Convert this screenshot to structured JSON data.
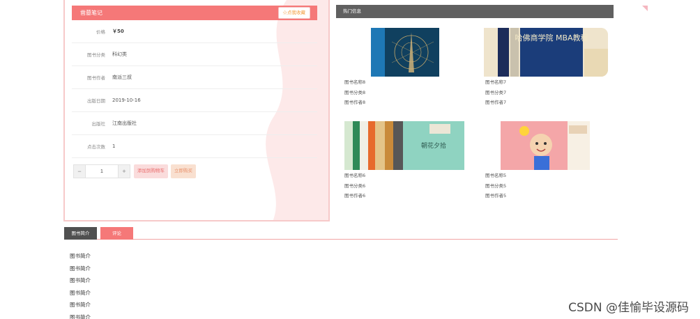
{
  "detail": {
    "title": "凿墓笔记",
    "collect_label": "☆点我收藏",
    "rows": [
      {
        "label": "价格",
        "value": "￥50"
      },
      {
        "label": "图书分类",
        "value": "科幻类"
      },
      {
        "label": "图书作者",
        "value": "南派三叔"
      },
      {
        "label": "出版日期",
        "value": "2019-10-16"
      },
      {
        "label": "出版社",
        "value": "江南出版社"
      },
      {
        "label": "点击次数",
        "value": "1"
      }
    ],
    "quantity": "1",
    "minus_label": "−",
    "plus_label": "+",
    "add_cart_label": "添加到购物车",
    "buy_now_label": "立即购买"
  },
  "hot": {
    "title": "热门信息",
    "items": [
      {
        "name": "图书名称8",
        "category": "图书分类8",
        "author": "图书作者8",
        "cover_title": ""
      },
      {
        "name": "图书名称7",
        "category": "图书分类7",
        "author": "图书作者7",
        "cover_title": "哈佛商学院 MBA教程"
      },
      {
        "name": "图书名称6",
        "category": "图书分类6",
        "author": "图书作者6",
        "cover_title": "朝花夕拾"
      },
      {
        "name": "图书名称5",
        "category": "图书分类5",
        "author": "图书作者5",
        "cover_title": ""
      }
    ]
  },
  "tabs": [
    {
      "label": "图书简介",
      "active": true
    },
    {
      "label": "评论",
      "active": false
    }
  ],
  "intro_lines": [
    "图书简介",
    "图书简介",
    "图书简介",
    "图书简介",
    "图书简介",
    "图书简介"
  ],
  "watermark": "CSDN @佳愉毕设源码",
  "colors": {
    "accent_red": "#f57878",
    "header_gray": "#606060",
    "collect_orange": "#f39d3e"
  }
}
